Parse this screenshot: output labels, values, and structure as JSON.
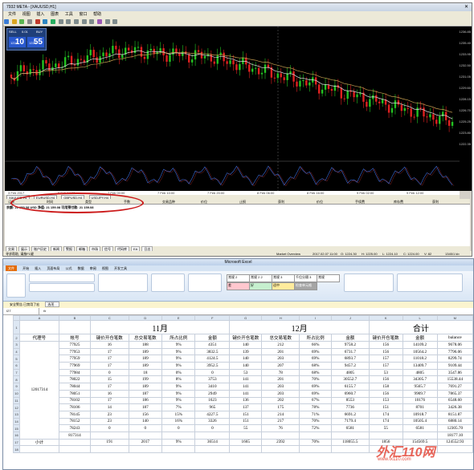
{
  "mt4": {
    "title": "7932 META - [XAUUSD,H1]",
    "menu": [
      "文件",
      "视图",
      "插入",
      "图表",
      "工具",
      "窗口",
      "帮助"
    ],
    "trade_panel": {
      "symbol": "XAUUSD,H1",
      "sell_label": "SELL",
      "buy_label": "BUY",
      "lot": "0.01",
      "bid_small": "1224",
      "bid_big": "10",
      "ask_small": "1224",
      "ask_big": "55"
    },
    "price_axis": [
      "1236.85",
      "1235.40",
      "1233.95",
      "1232.50",
      "1231.05",
      "1229.60",
      "1228.15",
      "1226.70",
      "1225.25",
      "1223.80",
      "1222.35"
    ],
    "date_labels": [
      "3 Feb 2017",
      "6 Feb 14:00",
      "7 Feb 00:00",
      "7 Feb 10:00",
      "7 Feb 20:00",
      "8 Feb 06:00",
      "8 Feb 16:00",
      "9 Feb 02:00",
      "9 Feb 12:00"
    ],
    "chart_tabs": [
      "XAUUSD,H1",
      "EURUSD,H4",
      "GBPUSD,H4",
      "USDJPY,H4"
    ],
    "terminal_headers": [
      "订单",
      "时间",
      "类型",
      "手数",
      "交易品种",
      "价位",
      "止损",
      "获利",
      "价位",
      "手续费",
      "库存费",
      "获利"
    ],
    "balance_line": "余额: 21 159.08 USD  净值: 21 159.08  可用预付款: 21 159.08",
    "terminal_tabs": [
      "交易",
      "展示",
      "账户历史",
      "新闻",
      "警报",
      "邮箱",
      "市场",
      "信号",
      "代码库",
      "EA",
      "日志"
    ],
    "status": {
      "help": "寻求帮助, 请按F1键",
      "profile": "Market Overview",
      "datetime": "2017.02.07 11:00",
      "open": "O: 1224.30",
      "high": "H: 1225.00",
      "low": "L: 1224.10",
      "close": "C: 1224.00",
      "vol": "V: 82",
      "traffic": "1345/1 kb"
    }
  },
  "excel": {
    "title": "Microsoft Excel",
    "ribbon_tabs": [
      "开始",
      "插入",
      "页面布局",
      "公式",
      "数据",
      "审阅",
      "视图",
      "开发工具"
    ],
    "styles": [
      "常规 2",
      "常规 2 2",
      "常规 3",
      "千位分隔 3",
      "常规",
      "差",
      "好",
      "适中",
      "检查单元格"
    ],
    "message_bar": "安全警告  已禁用了宏",
    "options_label": "选项...",
    "name_box": "I27",
    "col_headers": [
      "A",
      "B",
      "C",
      "D",
      "E",
      "F",
      "G",
      "H",
      "I",
      "J",
      "K",
      "L",
      "M"
    ],
    "month_nov": "11月",
    "month_dec": "12月",
    "month_total": "合计",
    "sub_headers": {
      "agent": "代理号",
      "account": "帐号",
      "count": "键价开仓笔数",
      "total": "总交易笔数",
      "ratio": "所占比例",
      "amount": "金额",
      "balance": "balance"
    },
    "agent_id": "12017314",
    "subtotal_label": "小计",
    "rows": [
      {
        "acc": "77925",
        "n1": "16",
        "t1": "188",
        "p1": "9%",
        "a1": "4351",
        "n2": "140",
        "t2": "212",
        "p2": "66%",
        "a2": "9758.2",
        "n3": "156",
        "a3": "14109.2",
        "bal": "9678.06"
      },
      {
        "acc": "77953",
        "n1": "17",
        "t1": "189",
        "p1": "9%",
        "a1": "3832.5",
        "n2": "139",
        "t2": "201",
        "p2": "69%",
        "a2": "6731.7",
        "n3": "156",
        "a3": "10564.2",
        "bal": "7796.06"
      },
      {
        "acc": "77959",
        "n1": "17",
        "t1": "189",
        "p1": "9%",
        "a1": "4124.5",
        "n2": "140",
        "t2": "203",
        "p2": "69%",
        "a2": "6893.7",
        "n3": "157",
        "a3": "11018.2",
        "bal": "8299.74"
      },
      {
        "acc": "77969",
        "n1": "17",
        "t1": "189",
        "p1": "9%",
        "a1": "3952.5",
        "n2": "140",
        "t2": "207",
        "p2": "68%",
        "a2": "9457.2",
        "n3": "157",
        "a3": "13409.7",
        "bal": "9109.44"
      },
      {
        "acc": "77984",
        "n1": "0",
        "t1": "18",
        "p1": "0%",
        "a1": "0",
        "n2": "53",
        "t2": "78",
        "p2": "68%",
        "a2": "4805",
        "n3": "53",
        "a3": "4805",
        "bal": "3547.86"
      },
      {
        "acc": "78022",
        "n1": "15",
        "t1": "199",
        "p1": "8%",
        "a1": "3753",
        "n2": "141",
        "t2": "201",
        "p2": "70%",
        "a2": "30552.7",
        "n3": "156",
        "a3": "34305.7",
        "bal": "15538.44"
      },
      {
        "acc": "78044",
        "n1": "17",
        "t1": "189",
        "p1": "9%",
        "a1": "3410",
        "n2": "141",
        "t2": "203",
        "p2": "69%",
        "a2": "6155.7",
        "n3": "158",
        "a3": "9565.7",
        "bal": "7691.27"
      },
      {
        "acc": "78051",
        "n1": "16",
        "t1": "187",
        "p1": "9%",
        "a1": "2949",
        "n2": "141",
        "t2": "203",
        "p2": "69%",
        "a2": "6960.7",
        "n3": "156",
        "a3": "9909.7",
        "bal": "7865.37"
      },
      {
        "acc": "78102",
        "n1": "17",
        "t1": "186",
        "p1": "9%",
        "a1": "1623",
        "n2": "136",
        "t2": "202",
        "p2": "67%",
        "a2": "8553",
        "n3": "153",
        "a3": "10176",
        "bal": "6548.60"
      },
      {
        "acc": "78106",
        "n1": "14",
        "t1": "187",
        "p1": "7%",
        "a1": "965",
        "n2": "137",
        "t2": "175",
        "p2": "78%",
        "a2": "7736",
        "n3": "151",
        "a3": "8701",
        "bal": "3426.38"
      },
      {
        "acc": "78145",
        "n1": "23",
        "t1": "156",
        "p1": "15%",
        "a1": "4227.5",
        "n2": "151",
        "t2": "214",
        "p2": "71%",
        "a2": "6691.2",
        "n3": "174",
        "a3": "10918.7",
        "bal": "8151.87"
      },
      {
        "acc": "78152",
        "n1": "23",
        "t1": "140",
        "p1": "16%",
        "a1": "3326",
        "n2": "151",
        "t2": "217",
        "p2": "70%",
        "a2": "7179.4",
        "n3": "174",
        "a3": "10505.4",
        "bal": "6880.14"
      },
      {
        "acc": "78243",
        "n1": "0",
        "t1": "0",
        "p1": "0",
        "a1": "0",
        "n2": "55",
        "t2": "76",
        "p2": "72%",
        "a2": "6581",
        "n3": "55",
        "a3": "6581",
        "bal": "12305.70"
      },
      {
        "acc": "817314",
        "n1": "",
        "t1": "",
        "p1": "",
        "a1": "",
        "n2": "",
        "t2": "",
        "p2": "",
        "a2": "",
        "n3": "",
        "a3": "",
        "bal": "18177.10"
      }
    ],
    "subtotal": {
      "n1": "191",
      "t1": "2017",
      "p1": "9%",
      "a1": "36514",
      "n2": "1665",
      "t2": "2392",
      "p2": "70%",
      "a2": "118055.5",
      "n3": "1856",
      "a3": "154569.5",
      "bal": "124552.93"
    }
  },
  "watermark": {
    "main": "外汇110网",
    "url": "www.fx110.com"
  },
  "colors": {
    "bull": "#22c322",
    "bear": "#e02020",
    "ellipse": "#cc1a1a",
    "watermark": "#e44a3c"
  }
}
